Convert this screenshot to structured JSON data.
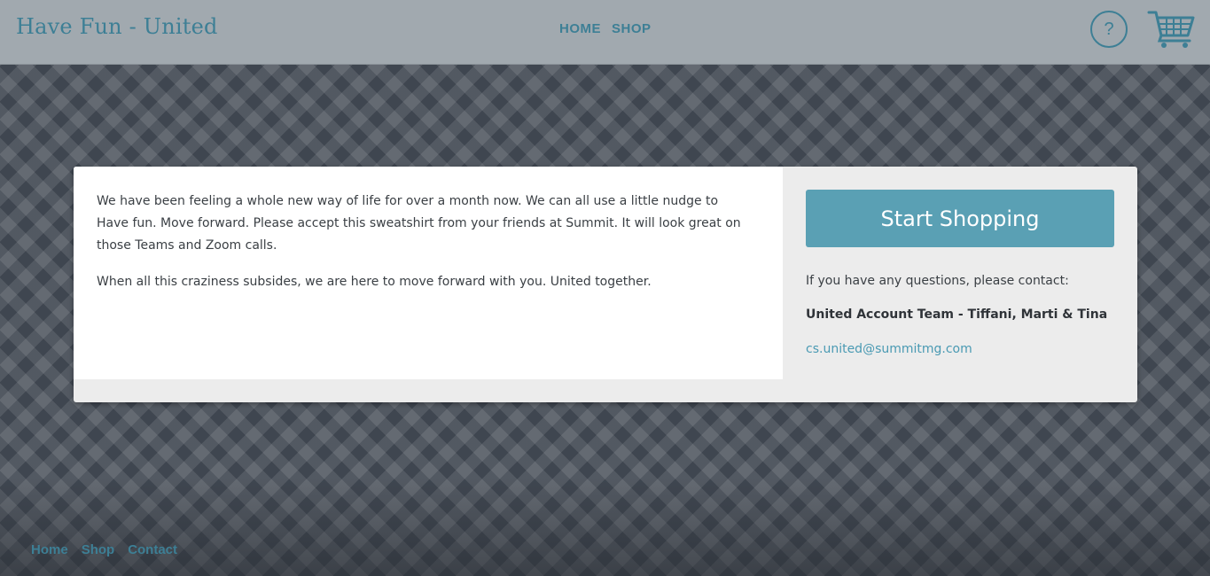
{
  "header": {
    "brand": "Have Fun - United",
    "nav": [
      "HOME",
      "SHOP"
    ],
    "help_symbol": "?",
    "help_icon": "question-circle-icon",
    "cart_icon": "shopping-cart-icon"
  },
  "main": {
    "paragraphs": [
      "We have been feeling a whole new way of life for over a month now. We can all use a little nudge to Have fun. Move forward. Please accept this sweatshirt from your friends at Summit. It will look great on those Teams and Zoom calls.",
      "When all this craziness subsides, we are here to move forward with you. United together."
    ],
    "cta_label": "Start Shopping",
    "contact_intro": "If you have any questions, please contact:",
    "contact_team": "United Account Team - Tiffani, Marti & Tina",
    "contact_email": "cs.united@summitmg.com"
  },
  "footer": {
    "links": [
      "Home",
      "Shop",
      "Contact"
    ]
  },
  "colors": {
    "header_bg": "#a1a9af",
    "accent": "#3d7f95",
    "button_bg": "#5aa0b4",
    "page_bg": "#3f4650"
  }
}
